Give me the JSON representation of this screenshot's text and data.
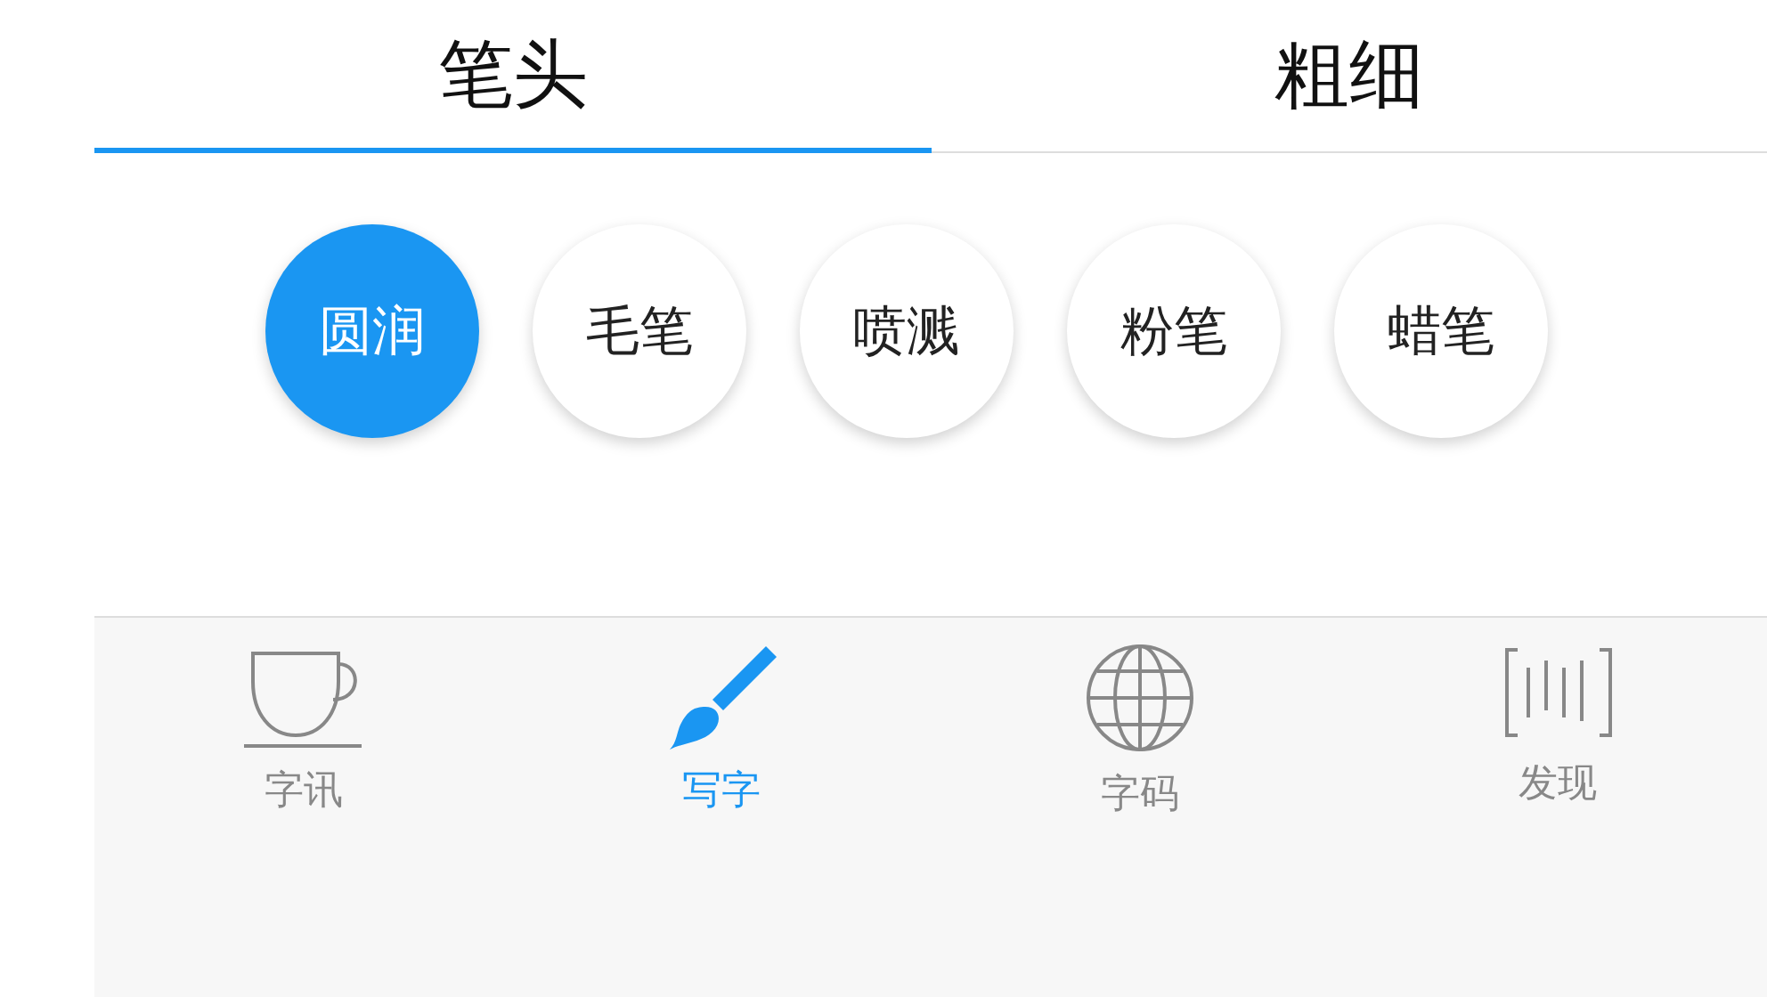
{
  "tabs": [
    {
      "label": "笔头",
      "selected": true
    },
    {
      "label": "粗细",
      "selected": false
    }
  ],
  "brushes": [
    {
      "label": "圆润",
      "selected": true
    },
    {
      "label": "毛笔",
      "selected": false
    },
    {
      "label": "喷溅",
      "selected": false
    },
    {
      "label": "粉笔",
      "selected": false
    },
    {
      "label": "蜡笔",
      "selected": false
    }
  ],
  "bottom_nav": [
    {
      "label": "字讯",
      "selected": false
    },
    {
      "label": "写字",
      "selected": true
    },
    {
      "label": "字码",
      "selected": false
    },
    {
      "label": "发现",
      "selected": false
    }
  ]
}
